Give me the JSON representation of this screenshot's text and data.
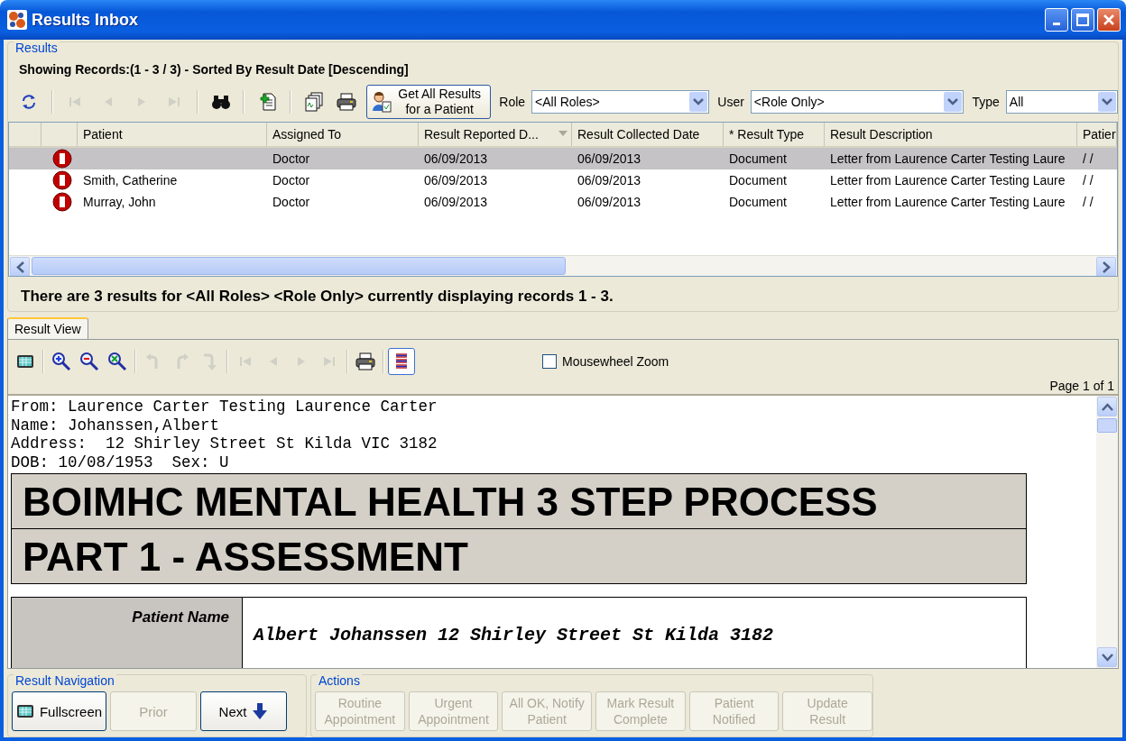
{
  "window": {
    "title": "Results Inbox"
  },
  "results": {
    "legend": "Results",
    "status": "Showing Records:(1 - 3 / 3) - Sorted By Result Date [Descending]",
    "toolbar": [
      {
        "kind": "refresh",
        "disabled": false
      },
      {
        "kind": "first",
        "disabled": true
      },
      {
        "kind": "prev",
        "disabled": true
      },
      {
        "kind": "next",
        "disabled": true
      },
      {
        "kind": "last",
        "disabled": true
      },
      {
        "kind": "find",
        "disabled": false
      },
      {
        "kind": "add-document",
        "disabled": false
      },
      {
        "kind": "documents",
        "disabled": false
      },
      {
        "kind": "print",
        "disabled": false
      }
    ],
    "get_all_button": {
      "line1": "Get All Results",
      "line2": "for a Patient"
    },
    "filters": [
      {
        "label": "Role",
        "value": "<All Roles>"
      },
      {
        "label": "User",
        "value": "<Role Only>"
      },
      {
        "label": "Type",
        "value": "All"
      }
    ],
    "table": {
      "columns": [
        {
          "label": "Patient",
          "sorted": false
        },
        {
          "label": "Assigned To",
          "sorted": false
        },
        {
          "label": "Result Reported D...",
          "sorted": true
        },
        {
          "label": "Result Collected Date",
          "sorted": false
        },
        {
          "label": "* Result Type",
          "sorted": false
        },
        {
          "label": "Result Description",
          "sorted": false
        },
        {
          "label": "Patier",
          "sorted": false
        }
      ],
      "rows": [
        {
          "selected": true,
          "flagged": true,
          "cells": [
            "",
            "Doctor",
            "06/09/2013",
            "06/09/2013",
            "Document",
            "Letter from Laurence Carter Testing Laure",
            "/ /"
          ]
        },
        {
          "selected": false,
          "flagged": true,
          "cells": [
            "Smith, Catherine",
            "Doctor",
            "06/09/2013",
            "06/09/2013",
            "Document",
            "Letter from Laurence Carter Testing Laure",
            "/ /"
          ]
        },
        {
          "selected": false,
          "flagged": true,
          "cells": [
            "Murray, John",
            "Doctor",
            "06/09/2013",
            "06/09/2013",
            "Document",
            "Letter from Laurence Carter Testing Laure",
            "/ /"
          ]
        }
      ]
    },
    "summary": "There are 3 results for <All Roles> <Role Only> currently displaying records 1 - 3."
  },
  "result_view": {
    "tab": {
      "label": "Result View",
      "selected": true
    },
    "toolbar": [
      {
        "kind": "screen",
        "disabled": false
      },
      {
        "kind": "zoom-in",
        "disabled": false
      },
      {
        "kind": "zoom-out",
        "disabled": false
      },
      {
        "kind": "zoom-fit",
        "disabled": false
      },
      {
        "kind": "rotate-left",
        "disabled": true
      },
      {
        "kind": "rotate-right",
        "disabled": true
      },
      {
        "kind": "turn",
        "disabled": true
      },
      {
        "kind": "first",
        "disabled": true
      },
      {
        "kind": "prev",
        "disabled": true
      },
      {
        "kind": "next",
        "disabled": true
      },
      {
        "kind": "last",
        "disabled": true
      },
      {
        "kind": "print",
        "disabled": false
      },
      {
        "kind": "lines",
        "disabled": false,
        "pressed": true
      }
    ],
    "mousewheel_zoom": {
      "label": "Mousewheel Zoom",
      "checked": false
    },
    "page_label": "Page 1 of 1",
    "document": {
      "header_lines": [
        "From: Laurence Carter Testing Laurence Carter",
        "Name: Johanssen,Albert",
        "Address:  12 Shirley Street St Kilda VIC 3182",
        "DOB: 10/08/1953  Sex: U"
      ],
      "titles": [
        "BOIMHC MENTAL HEALTH 3 STEP PROCESS",
        "PART 1  - ASSESSMENT"
      ],
      "field": {
        "label": "Patient Name",
        "value": "Albert Johanssen 12 Shirley Street St Kilda 3182"
      }
    }
  },
  "result_navigation": {
    "legend": "Result Navigation",
    "buttons": [
      {
        "kind": "fullscreen",
        "label": "Fullscreen",
        "disabled": false
      },
      {
        "kind": "plain",
        "label": "Prior",
        "disabled": true
      },
      {
        "kind": "next",
        "label": "Next",
        "disabled": false
      }
    ]
  },
  "actions": {
    "legend": "Actions",
    "buttons": [
      {
        "line1": "Routine",
        "line2": "Appointment",
        "disabled": true
      },
      {
        "line1": "Urgent",
        "line2": "Appointment",
        "disabled": true
      },
      {
        "line1": "All OK, Notify",
        "line2": "Patient",
        "disabled": true
      },
      {
        "line1": "Mark Result",
        "line2": "Complete",
        "disabled": true
      },
      {
        "line1": "Patient",
        "line2": "Notified",
        "disabled": true
      },
      {
        "line1": "Update",
        "line2": "Result",
        "disabled": true
      }
    ]
  }
}
